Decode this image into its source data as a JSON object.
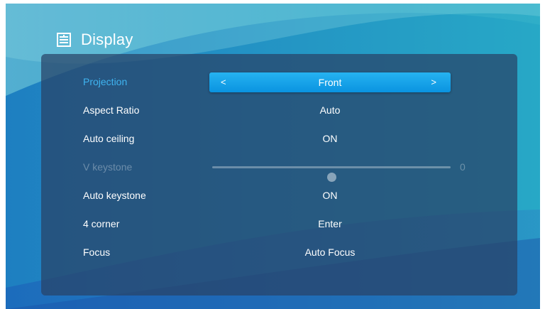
{
  "header": {
    "title": "Display",
    "icon": "display-settings-icon"
  },
  "menu": {
    "projection": {
      "label": "Projection",
      "value": "Front",
      "prev_arrow": "<",
      "next_arrow": ">"
    },
    "aspect_ratio": {
      "label": "Aspect Ratio",
      "value": "Auto"
    },
    "auto_ceiling": {
      "label": "Auto ceiling",
      "value": "ON"
    },
    "v_keystone": {
      "label": "V keystone",
      "value": "0",
      "level": 0.5,
      "enabled": false
    },
    "auto_keystone": {
      "label": "Auto keystone",
      "value": "ON"
    },
    "four_corner": {
      "label": "4 corner",
      "value": "Enter"
    },
    "focus": {
      "label": "Focus",
      "value": "Auto Focus"
    }
  },
  "colors": {
    "selected_highlight": "#0a93e0",
    "selected_label": "#3fb4f0",
    "panel": "#284266"
  }
}
